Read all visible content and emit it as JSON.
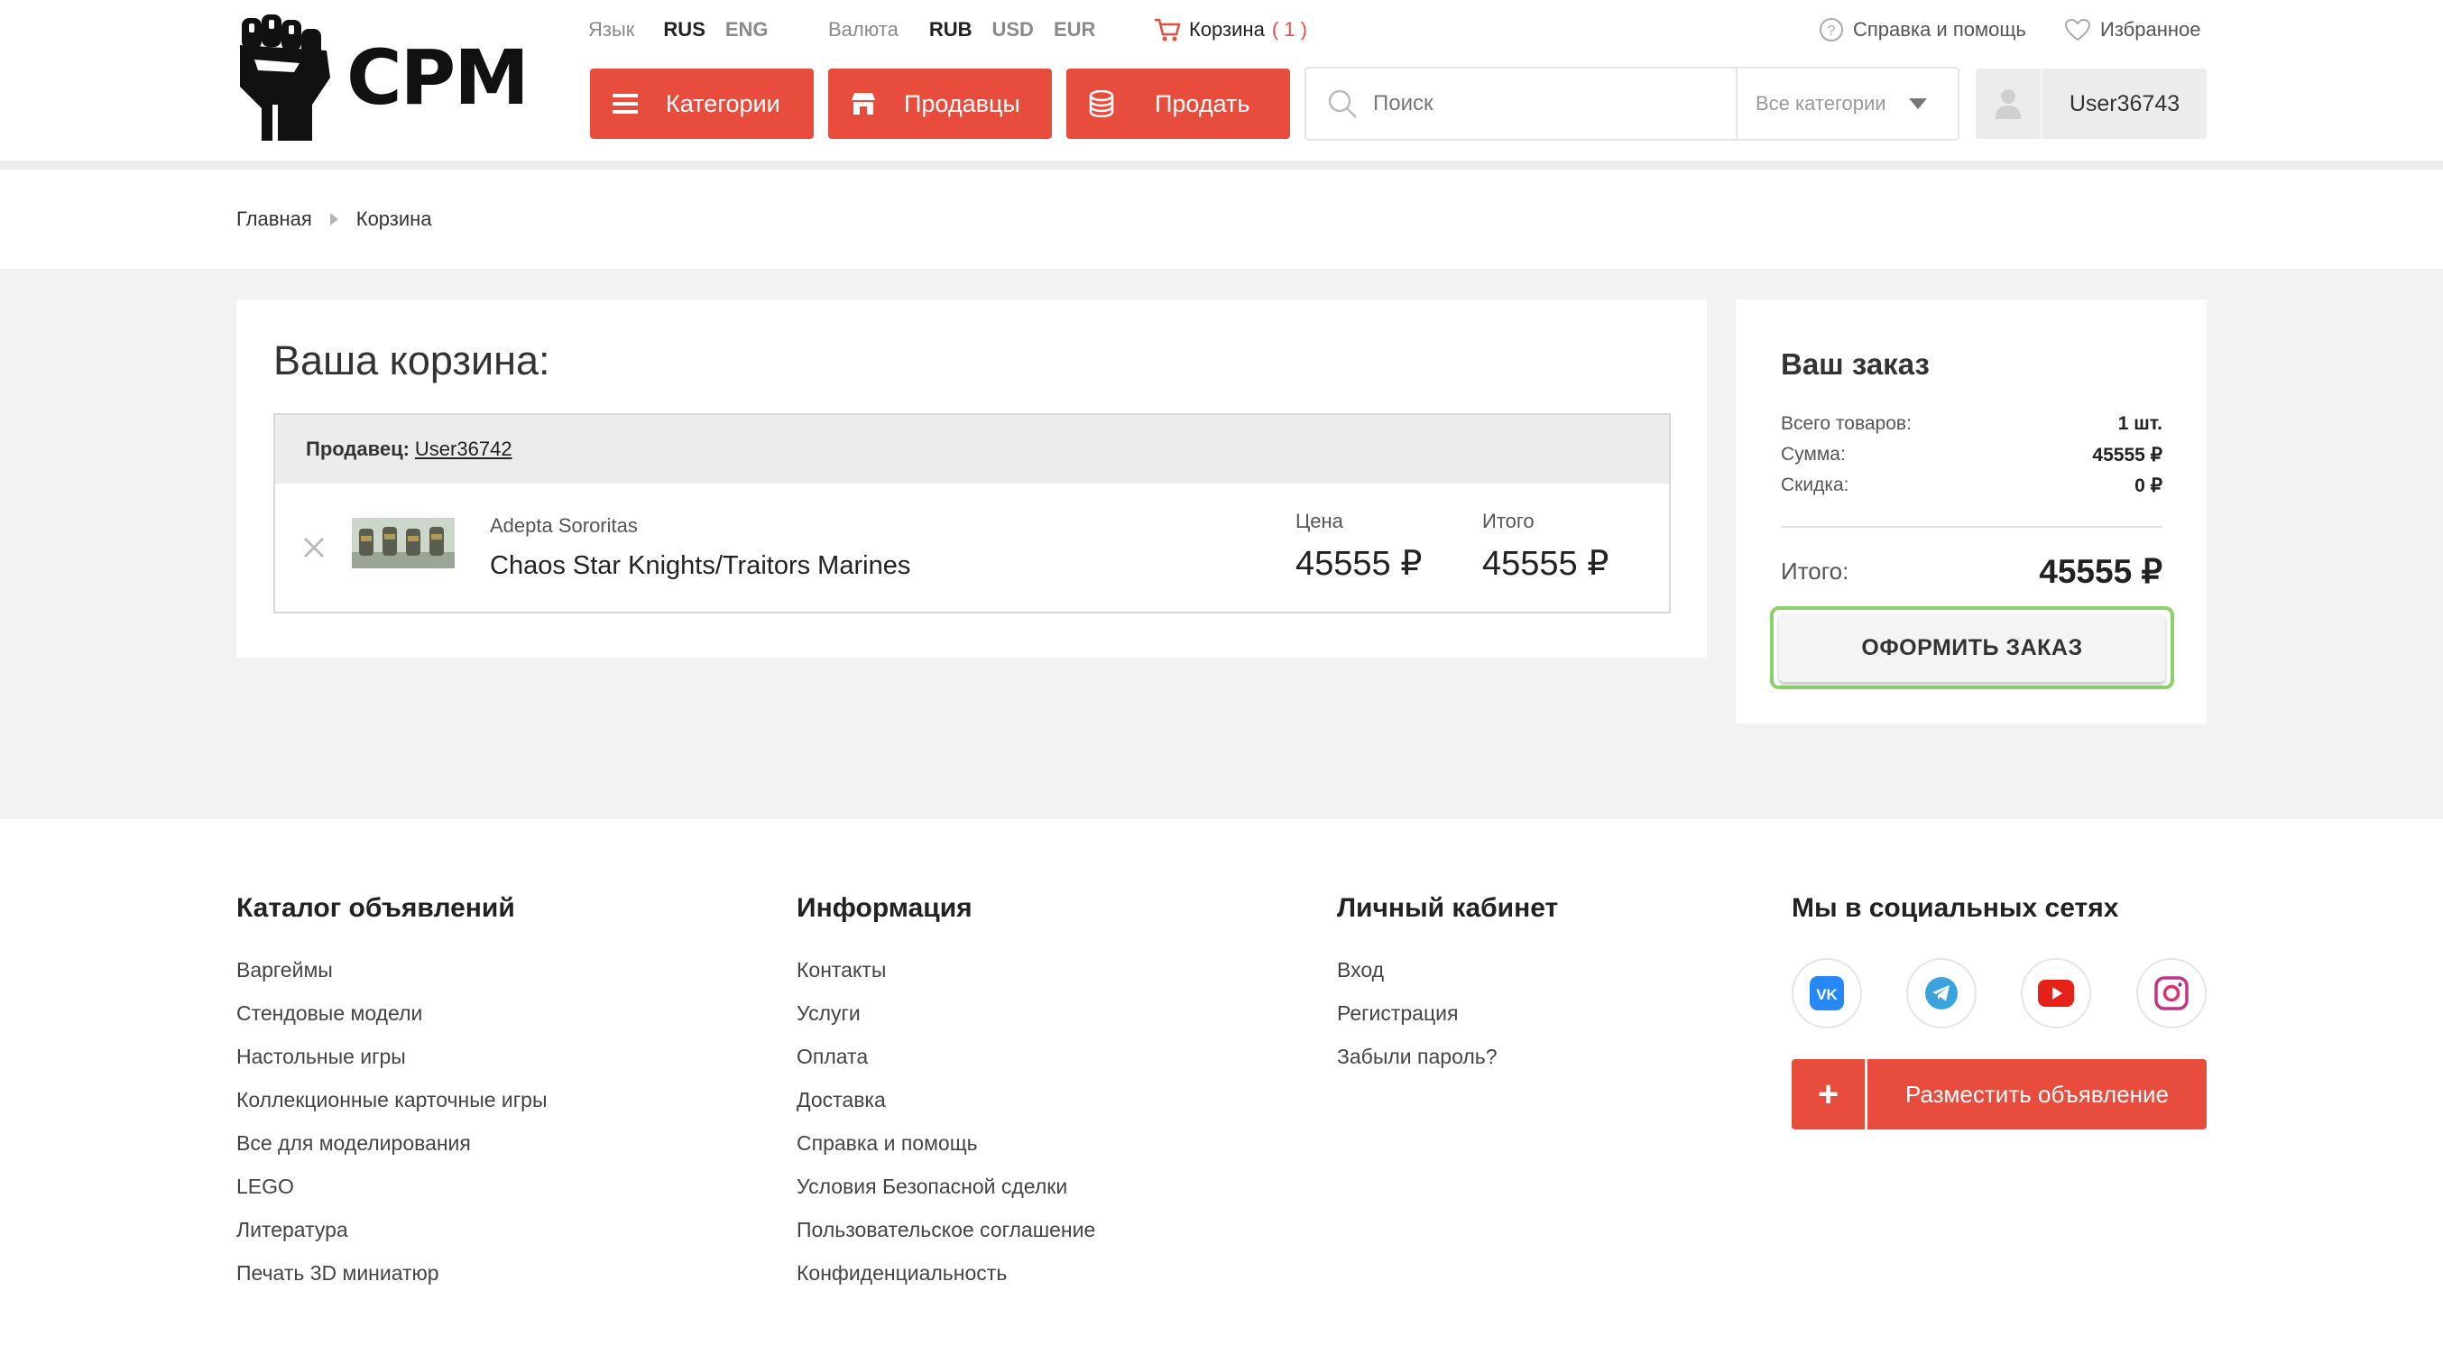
{
  "header": {
    "logo_text": "CPM",
    "language_label": "Язык",
    "languages": [
      "RUS",
      "ENG"
    ],
    "currency_label": "Валюта",
    "currencies": [
      "RUB",
      "USD",
      "EUR"
    ],
    "cart_label": "Корзина",
    "cart_count": "( 1 )",
    "help_label": "Справка и помощь",
    "favorites_label": "Избранное",
    "buttons": {
      "categories": "Категории",
      "sellers": "Продавцы",
      "sell": "Продать"
    },
    "search": {
      "placeholder": "Поиск",
      "category_select": "Все категории"
    },
    "username": "User36743",
    "colors": {
      "accent": "#e84c3d"
    }
  },
  "breadcrumb": {
    "home": "Главная",
    "current": "Корзина"
  },
  "cart": {
    "title": "Ваша корзина:",
    "seller_label": "Продавец:",
    "seller_name": "User36742",
    "item": {
      "category": "Adepta Sororitas",
      "name": "Chaos Star Knights/Traitors Marines",
      "price_label": "Цена",
      "price": "45555 ₽",
      "total_label": "Итого",
      "total": "45555 ₽"
    }
  },
  "order": {
    "title": "Ваш заказ",
    "rows": [
      {
        "label": "Всего товаров:",
        "value": "1 шт."
      },
      {
        "label": "Сумма:",
        "value": "45555 ₽"
      },
      {
        "label": "Скидка:",
        "value": "0 ₽"
      }
    ],
    "total_label": "Итого:",
    "total_value": "45555 ₽",
    "checkout_label": "ОФОРМИТЬ ЗАКАЗ"
  },
  "footer": {
    "catalog": {
      "title": "Каталог объявлений",
      "links": [
        "Варгеймы",
        "Стендовые модели",
        "Настольные игры",
        "Коллекционные карточные игры",
        "Все для моделирования",
        "LEGO",
        "Литература",
        "Печать 3D миниатюр"
      ]
    },
    "info": {
      "title": "Информация",
      "links": [
        "Контакты",
        "Услуги",
        "Оплата",
        "Доставка",
        "Справка и помощь",
        "Условия Безопасной сделки",
        "Пользовательское соглашение",
        "Конфиденциальность"
      ]
    },
    "account": {
      "title": "Личный кабинет",
      "links": [
        "Вход",
        "Регистрация",
        "Забыли пароль?"
      ]
    },
    "social": {
      "title": "Мы в социальных сетях",
      "icons": [
        "vk-icon",
        "telegram-icon",
        "youtube-icon",
        "instagram-icon"
      ]
    },
    "post_ad_label": "Разместить объявление",
    "post_ad_plus": "+"
  }
}
